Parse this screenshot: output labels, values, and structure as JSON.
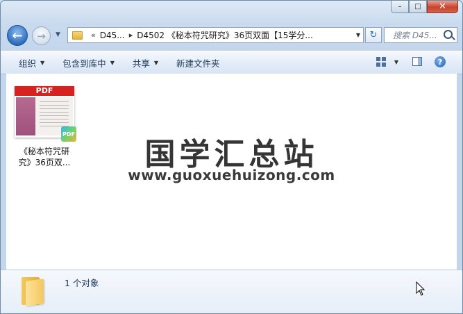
{
  "window": {
    "caption_buttons": {
      "minimize": "–",
      "maximize": "□",
      "close": "✕"
    }
  },
  "nav": {
    "back_symbol": "←",
    "forward_symbol": "→",
    "address": {
      "overflow": "«",
      "crumb1": "D45...",
      "separator": "▸",
      "crumb2": "D4502 《秘本符咒研究》36页双面【15学分..."
    },
    "search_placeholder": "搜索 D45..."
  },
  "toolbar": {
    "organize": "组织",
    "include_in_library": "包含到库中",
    "share": "共享",
    "new_folder": "新建文件夹"
  },
  "file": {
    "thumb_banner": "PDF",
    "badge": "PDF",
    "label_line1": "《秘本符咒研",
    "label_line2": "究》36页双..."
  },
  "watermark": {
    "title": "国学汇总站",
    "url": "www.guoxuehuizong.com"
  },
  "details": {
    "status": "1 个对象"
  },
  "colors": {
    "pdf_red": "#d7231f",
    "window_frame": "#c8daee",
    "close_button": "#c7432b"
  },
  "icons": [
    "back-arrow-icon",
    "forward-arrow-icon",
    "folder-icon",
    "refresh-icon",
    "search-icon",
    "views-icon",
    "preview-pane-icon",
    "help-icon",
    "pdf-icon",
    "folder-large-icon",
    "mouse-cursor-icon"
  ]
}
